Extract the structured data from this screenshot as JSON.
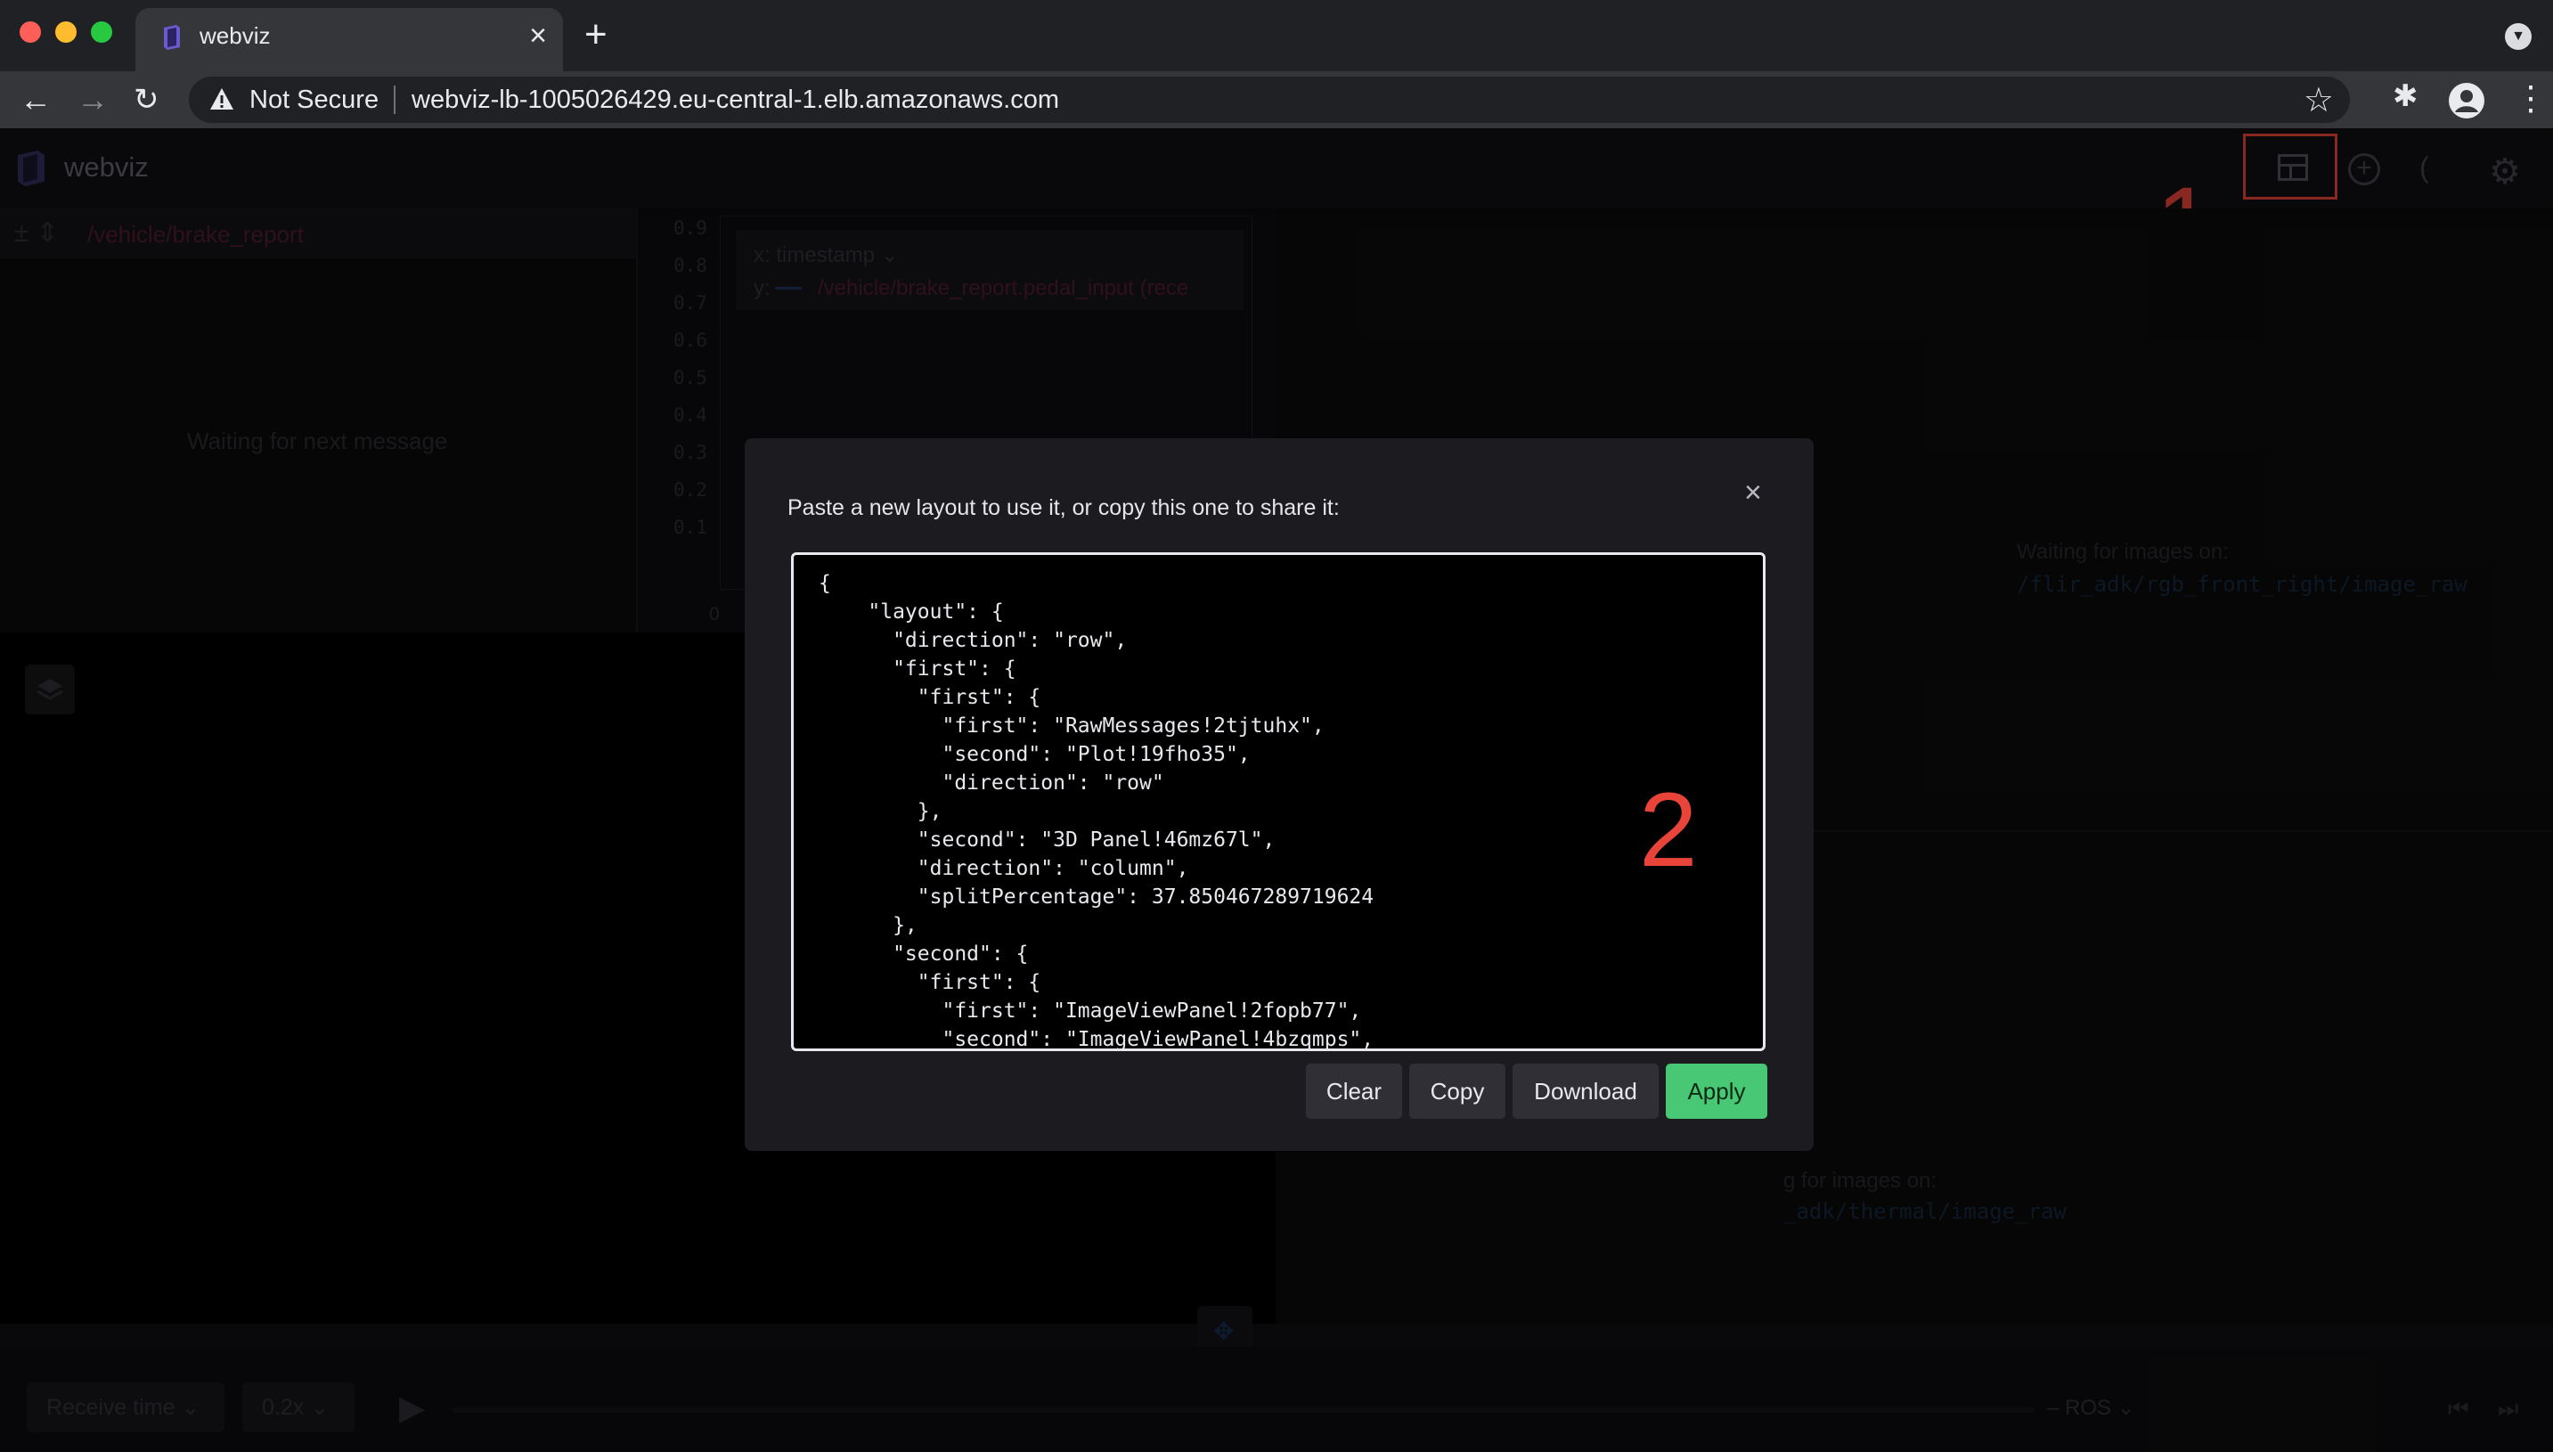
{
  "browser": {
    "tab_title": "webviz",
    "not_secure": "Not Secure",
    "url": "webviz-lb-1005026429.eu-central-1.elb.amazonaws.com"
  },
  "app": {
    "name": "webviz",
    "annotation_1": "1",
    "annotation_2": "2"
  },
  "raw_messages": {
    "topic": "/vehicle/brake_report",
    "waiting": "Waiting for next message"
  },
  "plot": {
    "y_ticks": [
      "0.9",
      "0.8",
      "0.7",
      "0.6",
      "0.5",
      "0.4",
      "0.3",
      "0.2",
      "0.1"
    ],
    "x_zero": "0",
    "x_label": "x:",
    "x_value": "timestamp",
    "y_label": "y:",
    "y_topic": "/vehicle/brake_report.pedal_input (rece"
  },
  "image_panels": {
    "first_waiting": "Waiting for images on:",
    "first_topic": "/flir_adk/rgb_front_right/image_raw",
    "second_waiting": "g for images on:",
    "second_topic": "_adk/thermal/image_raw"
  },
  "playback": {
    "time_mode": "Receive time",
    "speed": "0.2x",
    "source": "ROS"
  },
  "modal": {
    "title": "Paste a new layout to use it, or copy this one to share it:",
    "layout_json": "{\n    \"layout\": {\n      \"direction\": \"row\",\n      \"first\": {\n        \"first\": {\n          \"first\": \"RawMessages!2tjtuhx\",\n          \"second\": \"Plot!19fho35\",\n          \"direction\": \"row\"\n        },\n        \"second\": \"3D Panel!46mz67l\",\n        \"direction\": \"column\",\n        \"splitPercentage\": 37.850467289719624\n      },\n      \"second\": {\n        \"first\": {\n          \"first\": \"ImageViewPanel!2fopb77\",\n          \"second\": \"ImageViewPanel!4bzqmps\",",
    "clear_label": "Clear",
    "copy_label": "Copy",
    "download_label": "Download",
    "apply_label": "Apply"
  },
  "colors": {
    "apply": "#48c774",
    "annotation": "#e8443a"
  }
}
